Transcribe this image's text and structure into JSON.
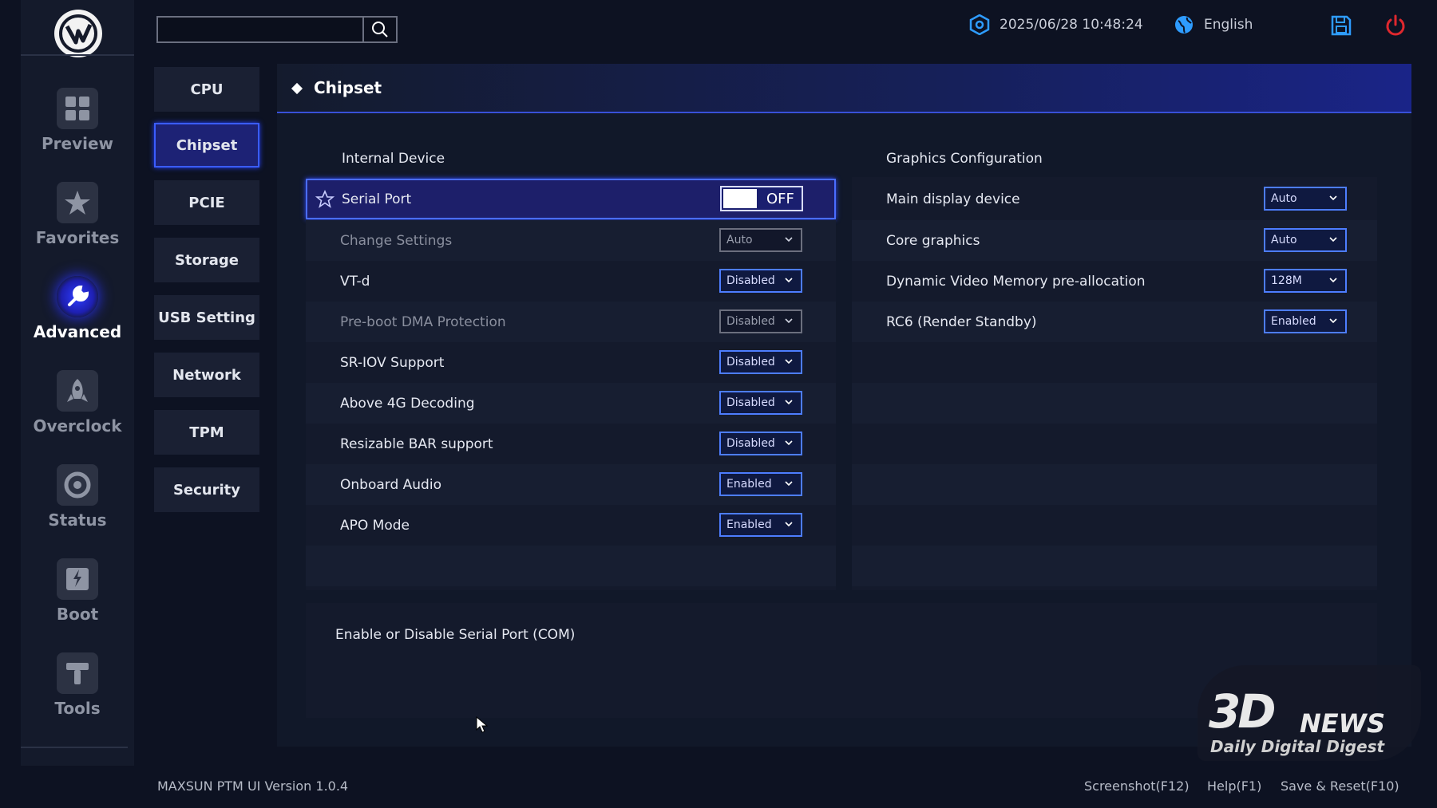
{
  "rail": {
    "items": [
      {
        "label": "Preview",
        "icon": "grid-icon"
      },
      {
        "label": "Favorites",
        "icon": "star-icon"
      },
      {
        "label": "Advanced",
        "icon": "wrench-icon"
      },
      {
        "label": "Overclock",
        "icon": "rocket-icon"
      },
      {
        "label": "Status",
        "icon": "gauge-icon"
      },
      {
        "label": "Boot",
        "icon": "ssd-icon"
      },
      {
        "label": "Tools",
        "icon": "hammer-icon"
      }
    ],
    "active": "Advanced"
  },
  "search": {
    "placeholder": ""
  },
  "top": {
    "datetime": "2025/06/28 10:48:24",
    "language": "English"
  },
  "submenu": {
    "items": [
      "CPU",
      "Chipset",
      "PCIE",
      "Storage",
      "USB Setting",
      "Network",
      "TPM",
      "Security"
    ],
    "active": "Chipset"
  },
  "main": {
    "title": "Chipset",
    "internal": {
      "title": "Internal Device",
      "rows": [
        {
          "label": "Serial Port",
          "control": "toggle",
          "value": "OFF"
        },
        {
          "label": "Change Settings",
          "control": "dropdown",
          "value": "Auto",
          "dim": true
        },
        {
          "label": "VT-d",
          "control": "dropdown",
          "value": "Disabled"
        },
        {
          "label": "Pre-boot DMA Protection",
          "control": "dropdown",
          "value": "Disabled",
          "dim": true
        },
        {
          "label": "SR-IOV Support",
          "control": "dropdown",
          "value": "Disabled"
        },
        {
          "label": "Above 4G Decoding",
          "control": "dropdown",
          "value": "Disabled"
        },
        {
          "label": "Resizable BAR support",
          "control": "dropdown",
          "value": "Disabled"
        },
        {
          "label": "Onboard Audio",
          "control": "dropdown",
          "value": "Enabled"
        },
        {
          "label": "APO Mode",
          "control": "dropdown",
          "value": "Enabled"
        }
      ]
    },
    "graphics": {
      "title": "Graphics Configuration",
      "rows": [
        {
          "label": "Main display device",
          "value": "Auto"
        },
        {
          "label": "Core graphics",
          "value": "Auto"
        },
        {
          "label": "Dynamic Video Memory pre-allocation",
          "value": "128M"
        },
        {
          "label": "RC6 (Render Standby)",
          "value": "Enabled"
        }
      ]
    },
    "help": "Enable or Disable Serial Port (COM)"
  },
  "footer": {
    "version": "MAXSUN PTM UI Version 1.0.4",
    "screenshot": "Screenshot(F12)",
    "help": "Help(F1)",
    "save_reset": "Save & Reset(F10)"
  },
  "watermark": {
    "main": "3D",
    "news": "NEWS",
    "sub": "Daily Digital Digest"
  },
  "colors": {
    "accent": "#3a5cff",
    "background": "#0d1222",
    "power": "#e0282e",
    "info_icon": "#2e9cff"
  }
}
